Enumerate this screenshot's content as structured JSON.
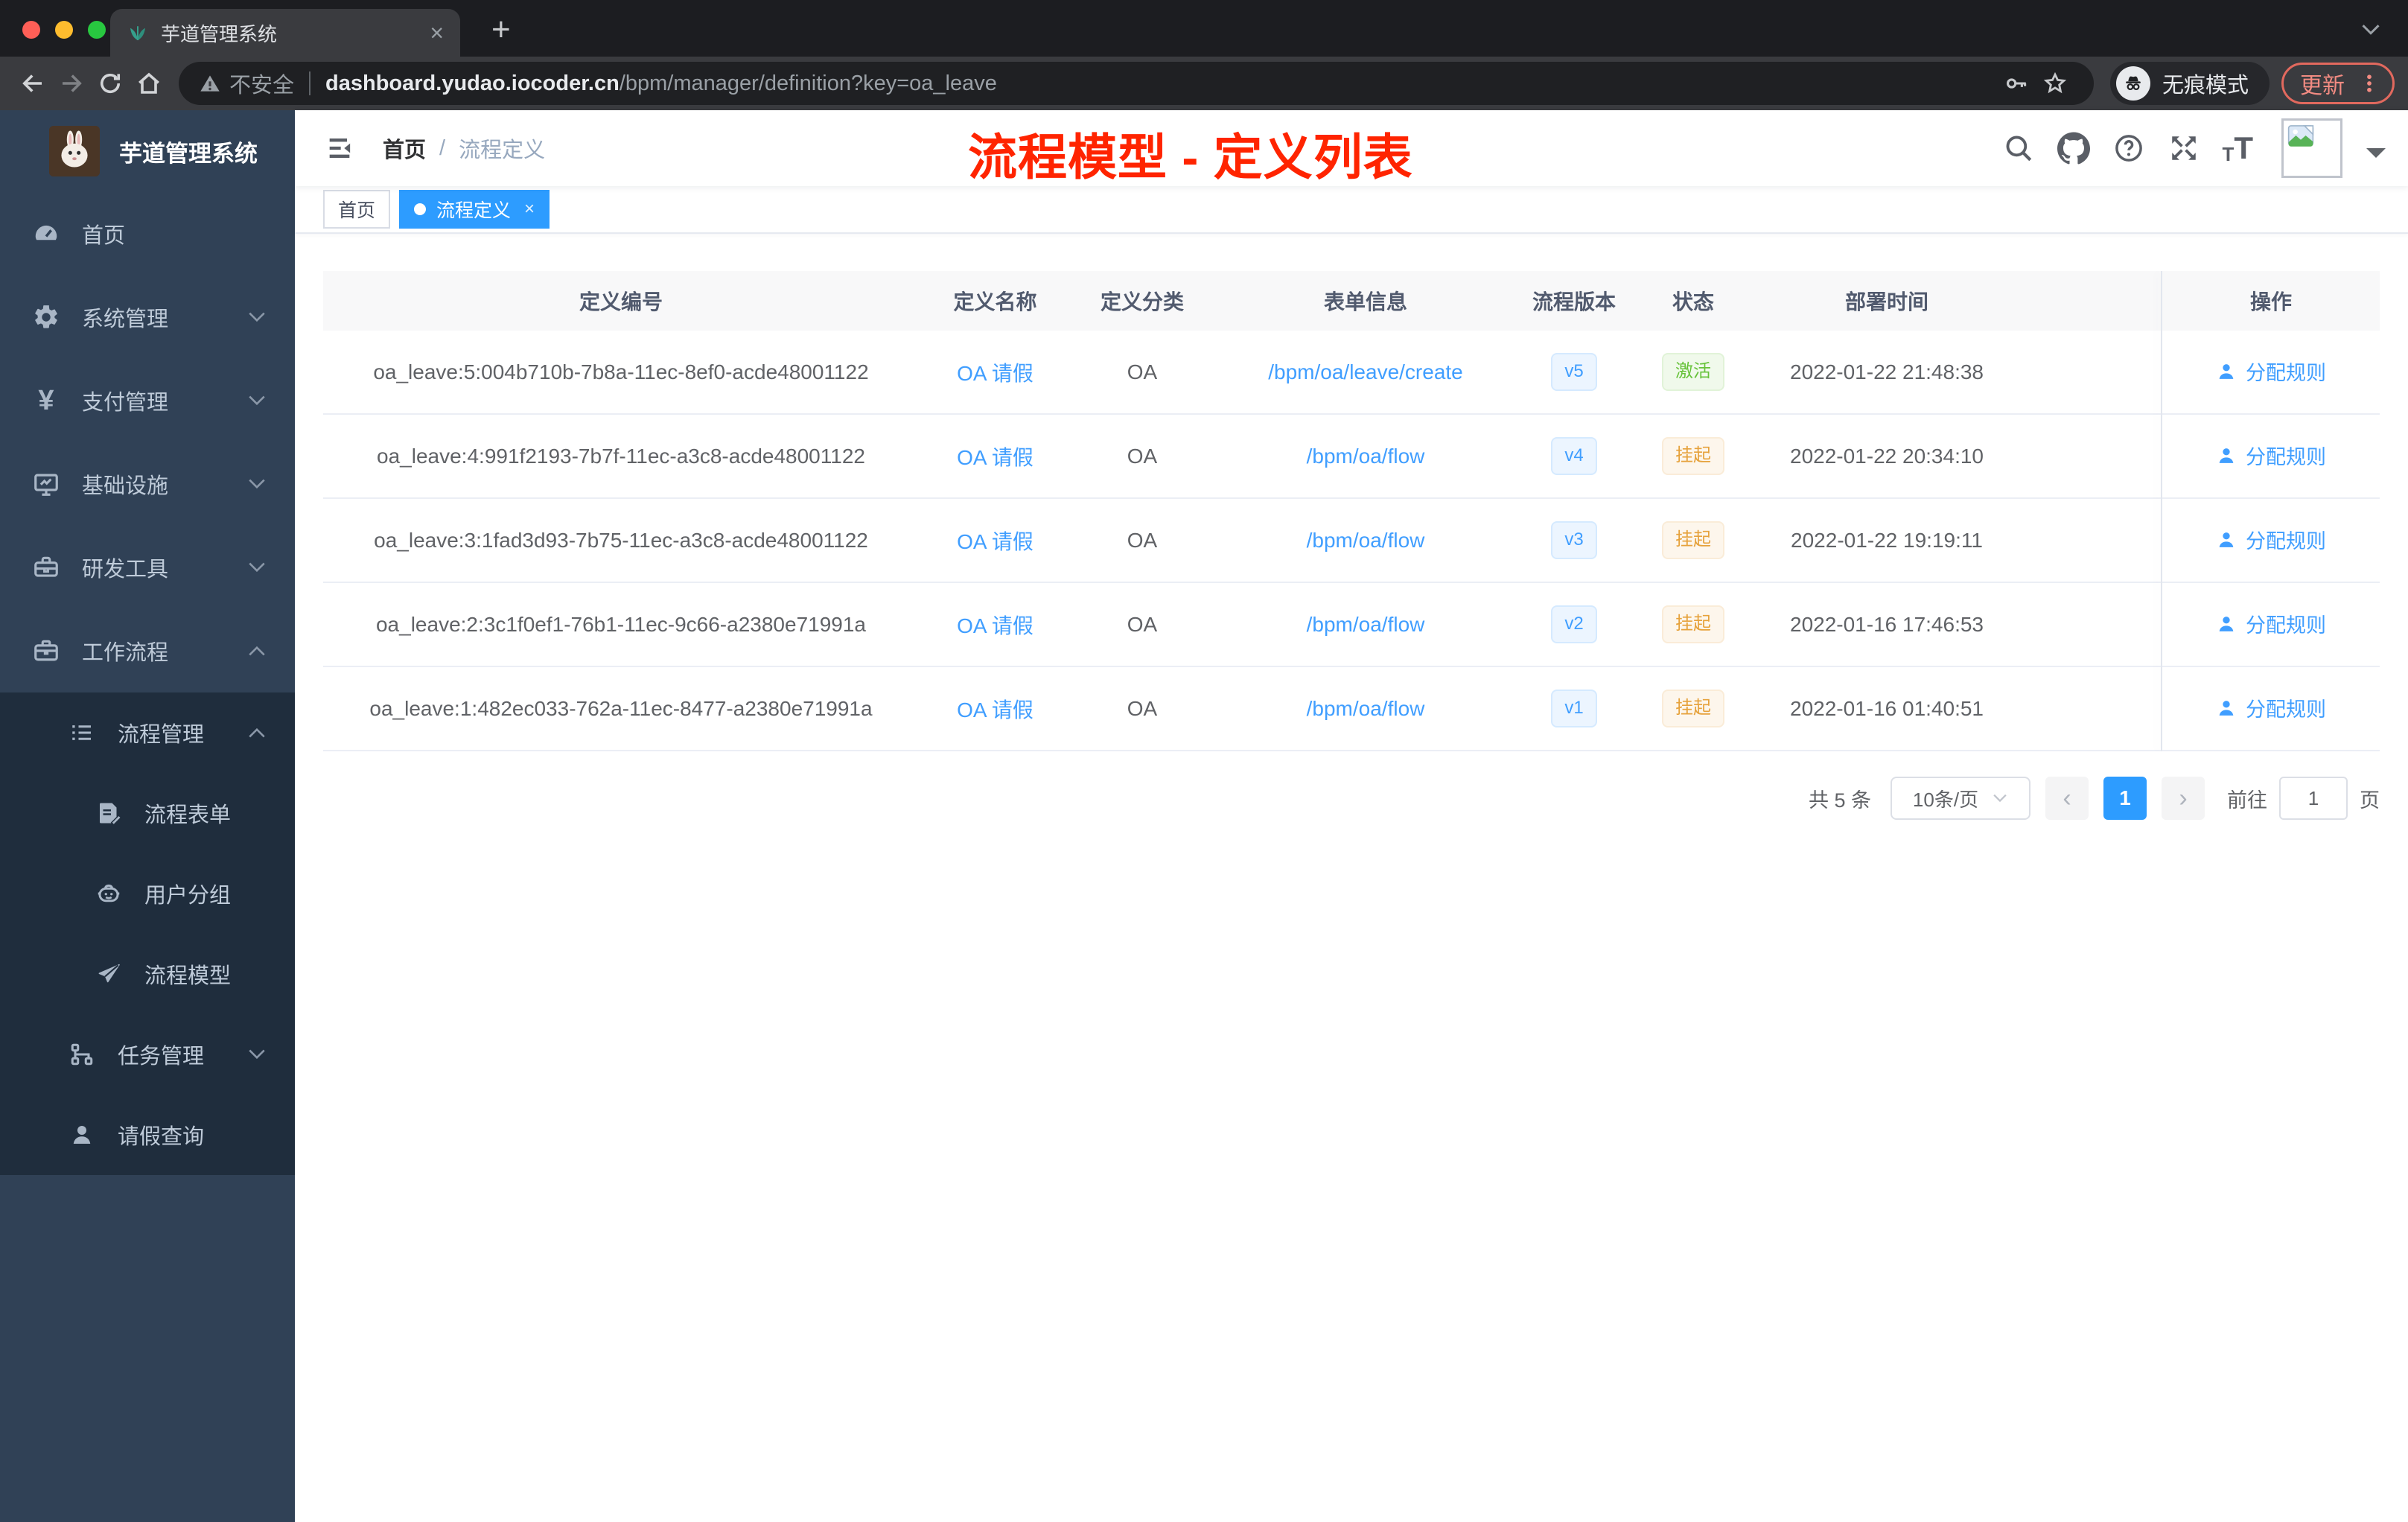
{
  "browser": {
    "tab_title": "芋道管理系统",
    "close_glyph": "×",
    "new_tab_glyph": "+",
    "security_label": "不安全",
    "url_host": "dashboard.yudao.iocoder.cn",
    "url_path": "/bpm/manager/definition?key=oa_leave",
    "incognito_label": "无痕模式",
    "update_label": "更新"
  },
  "sidebar": {
    "app_title": "芋道管理系统",
    "items": [
      {
        "label": "首页"
      },
      {
        "label": "系统管理"
      },
      {
        "label": "支付管理"
      },
      {
        "label": "基础设施"
      },
      {
        "label": "研发工具"
      },
      {
        "label": "工作流程"
      },
      {
        "label": "流程管理"
      },
      {
        "label": "流程表单"
      },
      {
        "label": "用户分组"
      },
      {
        "label": "流程模型"
      },
      {
        "label": "任务管理"
      },
      {
        "label": "请假查询"
      }
    ]
  },
  "navbar": {
    "breadcrumb": {
      "home": "首页",
      "separator": "/",
      "current": "流程定义"
    }
  },
  "annotation": {
    "text": "流程模型 - 定义列表",
    "color": "#ff2400"
  },
  "tags": [
    {
      "label": "首页",
      "active": false
    },
    {
      "label": "流程定义",
      "active": true
    }
  ],
  "table": {
    "columns": [
      "定义编号",
      "定义名称",
      "定义分类",
      "表单信息",
      "流程版本",
      "状态",
      "部署时间",
      "操作"
    ],
    "rows": [
      {
        "id": "oa_leave:5:004b710b-7b8a-11ec-8ef0-acde48001122",
        "name": "OA 请假",
        "category": "OA",
        "form": "/bpm/oa/leave/create",
        "version": "v5",
        "status": "激活",
        "status_type": "success",
        "deploy_time": "2022-01-22 21:48:38",
        "action": "分配规则"
      },
      {
        "id": "oa_leave:4:991f2193-7b7f-11ec-a3c8-acde48001122",
        "name": "OA 请假",
        "category": "OA",
        "form": "/bpm/oa/flow",
        "version": "v4",
        "status": "挂起",
        "status_type": "warning",
        "deploy_time": "2022-01-22 20:34:10",
        "action": "分配规则"
      },
      {
        "id": "oa_leave:3:1fad3d93-7b75-11ec-a3c8-acde48001122",
        "name": "OA 请假",
        "category": "OA",
        "form": "/bpm/oa/flow",
        "version": "v3",
        "status": "挂起",
        "status_type": "warning",
        "deploy_time": "2022-01-22 19:19:11",
        "action": "分配规则"
      },
      {
        "id": "oa_leave:2:3c1f0ef1-76b1-11ec-9c66-a2380e71991a",
        "name": "OA 请假",
        "category": "OA",
        "form": "/bpm/oa/flow",
        "version": "v2",
        "status": "挂起",
        "status_type": "warning",
        "deploy_time": "2022-01-16 17:46:53",
        "action": "分配规则"
      },
      {
        "id": "oa_leave:1:482ec033-762a-11ec-8477-a2380e71991a",
        "name": "OA 请假",
        "category": "OA",
        "form": "/bpm/oa/flow",
        "version": "v1",
        "status": "挂起",
        "status_type": "warning",
        "deploy_time": "2022-01-16 01:40:51",
        "action": "分配规则"
      }
    ]
  },
  "pagination": {
    "total": "共 5 条",
    "page_size": "10条/页",
    "prev": "‹",
    "current_page": "1",
    "next": "›",
    "goto_label": "前往",
    "goto_value": "1",
    "goto_suffix": "页"
  },
  "colors": {
    "accent": "#409eff",
    "active_tag": "#2d9cff",
    "success": "#67c23a",
    "warning": "#e6a23c",
    "annotation_red": "#ff2400",
    "sidebar_bg": "#304156",
    "submenu_bg": "#1f2d3d",
    "table_header_bg": "#f8f8f9"
  }
}
